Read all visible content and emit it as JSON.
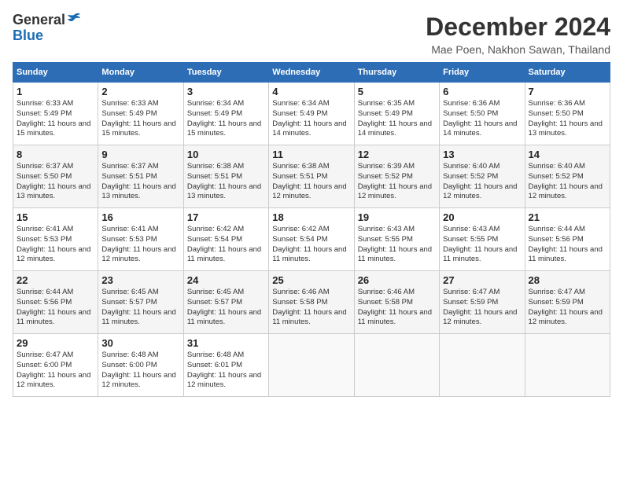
{
  "header": {
    "logo_general": "General",
    "logo_blue": "Blue",
    "month_title": "December 2024",
    "location": "Mae Poen, Nakhon Sawan, Thailand"
  },
  "weekdays": [
    "Sunday",
    "Monday",
    "Tuesday",
    "Wednesday",
    "Thursday",
    "Friday",
    "Saturday"
  ],
  "weeks": [
    [
      {
        "day": "1",
        "info": "Sunrise: 6:33 AM\nSunset: 5:49 PM\nDaylight: 11 hours and 15 minutes."
      },
      {
        "day": "2",
        "info": "Sunrise: 6:33 AM\nSunset: 5:49 PM\nDaylight: 11 hours and 15 minutes."
      },
      {
        "day": "3",
        "info": "Sunrise: 6:34 AM\nSunset: 5:49 PM\nDaylight: 11 hours and 15 minutes."
      },
      {
        "day": "4",
        "info": "Sunrise: 6:34 AM\nSunset: 5:49 PM\nDaylight: 11 hours and 14 minutes."
      },
      {
        "day": "5",
        "info": "Sunrise: 6:35 AM\nSunset: 5:49 PM\nDaylight: 11 hours and 14 minutes."
      },
      {
        "day": "6",
        "info": "Sunrise: 6:36 AM\nSunset: 5:50 PM\nDaylight: 11 hours and 14 minutes."
      },
      {
        "day": "7",
        "info": "Sunrise: 6:36 AM\nSunset: 5:50 PM\nDaylight: 11 hours and 13 minutes."
      }
    ],
    [
      {
        "day": "8",
        "info": "Sunrise: 6:37 AM\nSunset: 5:50 PM\nDaylight: 11 hours and 13 minutes."
      },
      {
        "day": "9",
        "info": "Sunrise: 6:37 AM\nSunset: 5:51 PM\nDaylight: 11 hours and 13 minutes."
      },
      {
        "day": "10",
        "info": "Sunrise: 6:38 AM\nSunset: 5:51 PM\nDaylight: 11 hours and 13 minutes."
      },
      {
        "day": "11",
        "info": "Sunrise: 6:38 AM\nSunset: 5:51 PM\nDaylight: 11 hours and 12 minutes."
      },
      {
        "day": "12",
        "info": "Sunrise: 6:39 AM\nSunset: 5:52 PM\nDaylight: 11 hours and 12 minutes."
      },
      {
        "day": "13",
        "info": "Sunrise: 6:40 AM\nSunset: 5:52 PM\nDaylight: 11 hours and 12 minutes."
      },
      {
        "day": "14",
        "info": "Sunrise: 6:40 AM\nSunset: 5:52 PM\nDaylight: 11 hours and 12 minutes."
      }
    ],
    [
      {
        "day": "15",
        "info": "Sunrise: 6:41 AM\nSunset: 5:53 PM\nDaylight: 11 hours and 12 minutes."
      },
      {
        "day": "16",
        "info": "Sunrise: 6:41 AM\nSunset: 5:53 PM\nDaylight: 11 hours and 12 minutes."
      },
      {
        "day": "17",
        "info": "Sunrise: 6:42 AM\nSunset: 5:54 PM\nDaylight: 11 hours and 11 minutes."
      },
      {
        "day": "18",
        "info": "Sunrise: 6:42 AM\nSunset: 5:54 PM\nDaylight: 11 hours and 11 minutes."
      },
      {
        "day": "19",
        "info": "Sunrise: 6:43 AM\nSunset: 5:55 PM\nDaylight: 11 hours and 11 minutes."
      },
      {
        "day": "20",
        "info": "Sunrise: 6:43 AM\nSunset: 5:55 PM\nDaylight: 11 hours and 11 minutes."
      },
      {
        "day": "21",
        "info": "Sunrise: 6:44 AM\nSunset: 5:56 PM\nDaylight: 11 hours and 11 minutes."
      }
    ],
    [
      {
        "day": "22",
        "info": "Sunrise: 6:44 AM\nSunset: 5:56 PM\nDaylight: 11 hours and 11 minutes."
      },
      {
        "day": "23",
        "info": "Sunrise: 6:45 AM\nSunset: 5:57 PM\nDaylight: 11 hours and 11 minutes."
      },
      {
        "day": "24",
        "info": "Sunrise: 6:45 AM\nSunset: 5:57 PM\nDaylight: 11 hours and 11 minutes."
      },
      {
        "day": "25",
        "info": "Sunrise: 6:46 AM\nSunset: 5:58 PM\nDaylight: 11 hours and 11 minutes."
      },
      {
        "day": "26",
        "info": "Sunrise: 6:46 AM\nSunset: 5:58 PM\nDaylight: 11 hours and 11 minutes."
      },
      {
        "day": "27",
        "info": "Sunrise: 6:47 AM\nSunset: 5:59 PM\nDaylight: 11 hours and 12 minutes."
      },
      {
        "day": "28",
        "info": "Sunrise: 6:47 AM\nSunset: 5:59 PM\nDaylight: 11 hours and 12 minutes."
      }
    ],
    [
      {
        "day": "29",
        "info": "Sunrise: 6:47 AM\nSunset: 6:00 PM\nDaylight: 11 hours and 12 minutes."
      },
      {
        "day": "30",
        "info": "Sunrise: 6:48 AM\nSunset: 6:00 PM\nDaylight: 11 hours and 12 minutes."
      },
      {
        "day": "31",
        "info": "Sunrise: 6:48 AM\nSunset: 6:01 PM\nDaylight: 11 hours and 12 minutes."
      },
      {
        "day": "",
        "info": ""
      },
      {
        "day": "",
        "info": ""
      },
      {
        "day": "",
        "info": ""
      },
      {
        "day": "",
        "info": ""
      }
    ]
  ]
}
